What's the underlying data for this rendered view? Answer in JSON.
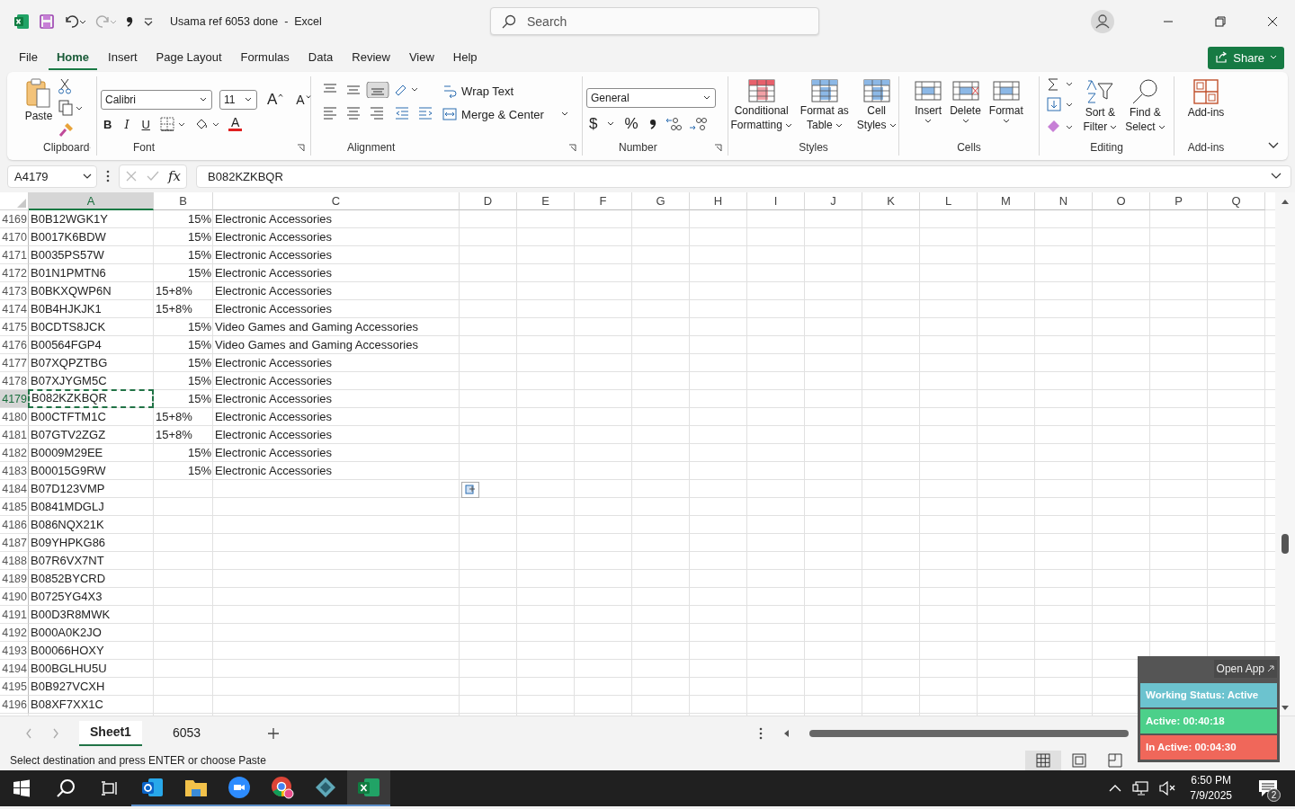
{
  "title_bar": {
    "title": "Usama ref 6053 done  -  Excel",
    "search_placeholder": "Search"
  },
  "menu_tabs": [
    {
      "label": "File",
      "selected": false
    },
    {
      "label": "Home",
      "selected": true
    },
    {
      "label": "Insert",
      "selected": false
    },
    {
      "label": "Page Layout",
      "selected": false
    },
    {
      "label": "Formulas",
      "selected": false
    },
    {
      "label": "Data",
      "selected": false
    },
    {
      "label": "Review",
      "selected": false
    },
    {
      "label": "View",
      "selected": false
    },
    {
      "label": "Help",
      "selected": false
    }
  ],
  "share_button": "Share",
  "ribbon": {
    "clipboard": {
      "paste": "Paste",
      "label": "Clipboard"
    },
    "font": {
      "name": "Calibri",
      "size": "11",
      "grow": "A",
      "shrink": "A",
      "bold": "B",
      "italic": "I",
      "underline": "U",
      "font_color_letter": "A",
      "label": "Font"
    },
    "alignment": {
      "wrap": "Wrap Text",
      "merge": "Merge & Center",
      "label": "Alignment"
    },
    "number": {
      "format": "General",
      "currency": "$",
      "percent": "%",
      "label": "Number"
    },
    "styles": {
      "buttons": [
        {
          "lines": [
            "Conditional",
            "Formatting"
          ]
        },
        {
          "lines": [
            "Format as",
            "Table"
          ]
        },
        {
          "lines": [
            "Cell",
            "Styles"
          ]
        }
      ],
      "label": "Styles"
    },
    "cells": {
      "buttons": [
        "Insert",
        "Delete",
        "Format"
      ],
      "label": "Cells"
    },
    "editing": {
      "buttons": [
        {
          "lines": [
            "Sort &",
            "Filter"
          ]
        },
        {
          "lines": [
            "Find &",
            "Select"
          ]
        }
      ],
      "label": "Editing"
    },
    "addins": {
      "button": "Add-ins",
      "label": "Add-ins"
    }
  },
  "formula_bar": {
    "name_box": "A4179",
    "fx": "fx",
    "value": "B082KZKBQR"
  },
  "columns": [
    {
      "label": "A",
      "selected": true
    },
    {
      "label": "B",
      "selected": false
    },
    {
      "label": "C",
      "selected": false
    },
    {
      "label": "D",
      "selected": false
    },
    {
      "label": "E",
      "selected": false
    },
    {
      "label": "F",
      "selected": false
    },
    {
      "label": "G",
      "selected": false
    },
    {
      "label": "H",
      "selected": false
    },
    {
      "label": "I",
      "selected": false
    },
    {
      "label": "J",
      "selected": false
    },
    {
      "label": "K",
      "selected": false
    },
    {
      "label": "L",
      "selected": false
    },
    {
      "label": "M",
      "selected": false
    },
    {
      "label": "N",
      "selected": false
    },
    {
      "label": "O",
      "selected": false
    },
    {
      "label": "P",
      "selected": false
    },
    {
      "label": "Q",
      "selected": false
    }
  ],
  "rows": [
    {
      "number": "4169",
      "a": "B0B12WGK1Y",
      "b": {
        "text": "15%",
        "kind": "number"
      },
      "c": "Electronic Accessories",
      "selected": false
    },
    {
      "number": "4170",
      "a": "B0017K6BDW",
      "b": {
        "text": "15%",
        "kind": "number"
      },
      "c": "Electronic Accessories",
      "selected": false
    },
    {
      "number": "4171",
      "a": "B0035PS57W",
      "b": {
        "text": "15%",
        "kind": "number"
      },
      "c": "Electronic Accessories",
      "selected": false
    },
    {
      "number": "4172",
      "a": "B01N1PMTN6",
      "b": {
        "text": "15%",
        "kind": "number"
      },
      "c": "Electronic Accessories",
      "selected": false
    },
    {
      "number": "4173",
      "a": "B0BKXQWP6N",
      "b": {
        "text": "15+8%",
        "kind": "text"
      },
      "c": "Electronic Accessories",
      "selected": false
    },
    {
      "number": "4174",
      "a": "B0B4HJKJK1",
      "b": {
        "text": "15+8%",
        "kind": "text"
      },
      "c": "Electronic Accessories",
      "selected": false
    },
    {
      "number": "4175",
      "a": "B0CDTS8JCK",
      "b": {
        "text": "15%",
        "kind": "number"
      },
      "c": "Video Games and Gaming Accessories",
      "selected": false
    },
    {
      "number": "4176",
      "a": "B00564FGP4",
      "b": {
        "text": "15%",
        "kind": "number"
      },
      "c": "Video Games and Gaming Accessories",
      "selected": false
    },
    {
      "number": "4177",
      "a": "B07XQPZTBG",
      "b": {
        "text": "15%",
        "kind": "number"
      },
      "c": "Electronic Accessories",
      "selected": false
    },
    {
      "number": "4178",
      "a": "B07XJYGM5C",
      "b": {
        "text": "15%",
        "kind": "number"
      },
      "c": "Electronic Accessories",
      "selected": false
    },
    {
      "number": "4179",
      "a": "B082KZKBQR",
      "b": {
        "text": "15%",
        "kind": "number"
      },
      "c": "Electronic Accessories",
      "selected": true
    },
    {
      "number": "4180",
      "a": "B00CTFTM1C",
      "b": {
        "text": "15+8%",
        "kind": "text"
      },
      "c": "Electronic Accessories",
      "selected": false
    },
    {
      "number": "4181",
      "a": "B07GTV2ZGZ",
      "b": {
        "text": "15+8%",
        "kind": "text"
      },
      "c": "Electronic Accessories",
      "selected": false
    },
    {
      "number": "4182",
      "a": "B0009M29EE",
      "b": {
        "text": "15%",
        "kind": "number"
      },
      "c": "Electronic Accessories",
      "selected": false
    },
    {
      "number": "4183",
      "a": "B00015G9RW",
      "b": {
        "text": "15%",
        "kind": "number"
      },
      "c": "Electronic Accessories",
      "selected": false
    },
    {
      "number": "4184",
      "a": "B07D123VMP",
      "selected": false
    },
    {
      "number": "4185",
      "a": "B0841MDGLJ",
      "selected": false
    },
    {
      "number": "4186",
      "a": "B086NQX21K",
      "selected": false
    },
    {
      "number": "4187",
      "a": "B09YHPKG86",
      "selected": false
    },
    {
      "number": "4188",
      "a": "B07R6VX7NT",
      "selected": false
    },
    {
      "number": "4189",
      "a": "B0852BYCRD",
      "selected": false
    },
    {
      "number": "4190",
      "a": "B0725YG4X3",
      "selected": false
    },
    {
      "number": "4191",
      "a": "B00D3R8MWK",
      "selected": false
    },
    {
      "number": "4192",
      "a": "B000A0K2JO",
      "selected": false
    },
    {
      "number": "4193",
      "a": "B00066HOXY",
      "selected": false
    },
    {
      "number": "4194",
      "a": "B00BGLHU5U",
      "selected": false
    },
    {
      "number": "4195",
      "a": "B0B927VCXH",
      "selected": false
    },
    {
      "number": "4196",
      "a": "B08XF7XX1C",
      "selected": false
    }
  ],
  "sheet_tabs": [
    {
      "label": "Sheet1",
      "selected": true
    },
    {
      "label": "6053",
      "selected": false
    }
  ],
  "status_bar": {
    "message": "Select destination and press ENTER or choose Paste"
  },
  "tracker": {
    "open_app": "Open App",
    "items": [
      {
        "text": "Working Status: Active",
        "color": "#6cc3cf"
      },
      {
        "text": "Active: 00:40:18",
        "color": "#4cd08a"
      },
      {
        "text": "In Active: 00:04:30",
        "color": "#f0675a"
      }
    ]
  },
  "taskbar": {
    "apps": [
      {
        "kind": "outlook",
        "active": false
      },
      {
        "kind": "explorer",
        "active": false
      },
      {
        "kind": "zoom",
        "active": false
      },
      {
        "kind": "chrome",
        "active": false
      },
      {
        "kind": "diamond",
        "active": false
      },
      {
        "kind": "excel",
        "active": true
      }
    ],
    "time": "6:50 PM",
    "date": "7/9/2025",
    "notifications": "2"
  }
}
